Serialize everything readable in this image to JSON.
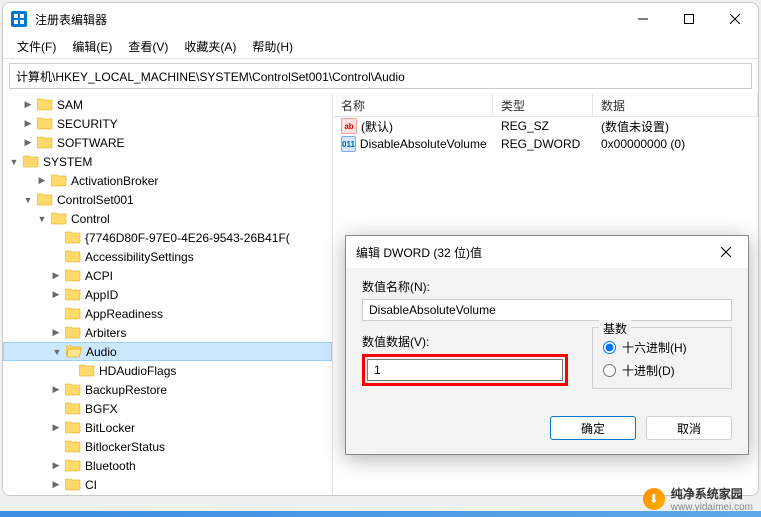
{
  "window": {
    "title": "注册表编辑器"
  },
  "menu": {
    "file": "文件(F)",
    "edit": "编辑(E)",
    "view": "查看(V)",
    "fav": "收藏夹(A)",
    "help": "帮助(H)"
  },
  "address": "计算机\\HKEY_LOCAL_MACHINE\\SYSTEM\\ControlSet001\\Control\\Audio",
  "tree": {
    "sam": "SAM",
    "security": "SECURITY",
    "software": "SOFTWARE",
    "system": "SYSTEM",
    "activationbroker": "ActivationBroker",
    "controlset001": "ControlSet001",
    "control": "Control",
    "guid": "{7746D80F-97E0-4E26-9543-26B41F(",
    "accessibility": "AccessibilitySettings",
    "acpi": "ACPI",
    "appid": "AppID",
    "appreadiness": "AppReadiness",
    "arbiters": "Arbiters",
    "audio": "Audio",
    "hdaudioflags": "HDAudioFlags",
    "backuprestore": "BackupRestore",
    "bgfx": "BGFX",
    "bitlocker": "BitLocker",
    "bitlockerstatus": "BitlockerStatus",
    "bluetooth": "Bluetooth",
    "ci": "CI"
  },
  "list": {
    "headers": {
      "name": "名称",
      "type": "类型",
      "data": "数据"
    },
    "rows": [
      {
        "icon": "sz",
        "name": "(默认)",
        "type": "REG_SZ",
        "data": "(数值未设置)"
      },
      {
        "icon": "dw",
        "name": "DisableAbsoluteVolume",
        "type": "REG_DWORD",
        "data": "0x00000000 (0)"
      }
    ]
  },
  "dialog": {
    "title": "编辑 DWORD (32 位)值",
    "name_label": "数值名称(N):",
    "name_value": "DisableAbsoluteVolume",
    "data_label": "数值数据(V):",
    "data_value": "1",
    "radix_label": "基数",
    "radix_hex": "十六进制(H)",
    "radix_dec": "十进制(D)",
    "ok": "确定",
    "cancel": "取消"
  },
  "watermark": {
    "text": "纯净系统家园",
    "url": "www.yidaimei.com"
  }
}
